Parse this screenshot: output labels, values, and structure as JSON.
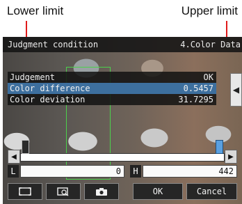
{
  "callouts": {
    "lower_limit": "Lower limit",
    "upper_limit": "Upper limit"
  },
  "screen": {
    "title": "Judgment condition",
    "item": "4.Color Data",
    "results": [
      {
        "label": "Judgement",
        "value": "OK",
        "selected": false
      },
      {
        "label": "Color difference",
        "value": "0.5457",
        "selected": true
      },
      {
        "label": "Color deviation",
        "value": "31.7295",
        "selected": false
      }
    ],
    "limits": {
      "lower_label": "L",
      "lower_value": "0",
      "upper_label": "H",
      "upper_value": "442"
    },
    "buttons": {
      "ok": "OK",
      "cancel": "Cancel"
    }
  },
  "icons": {
    "side_arrow": "chevron-left-icon",
    "slider_left": "triangle-left-icon",
    "slider_right": "triangle-right-icon",
    "full_view": "full-view-icon",
    "zoom": "zoom-icon",
    "capture": "camera-icon"
  },
  "colors": {
    "leader_line": "#e01b1b",
    "roi_outline": "#4cd14c",
    "selected_row": "#3d6f9e",
    "upper_handle": "#5aa0e0"
  }
}
